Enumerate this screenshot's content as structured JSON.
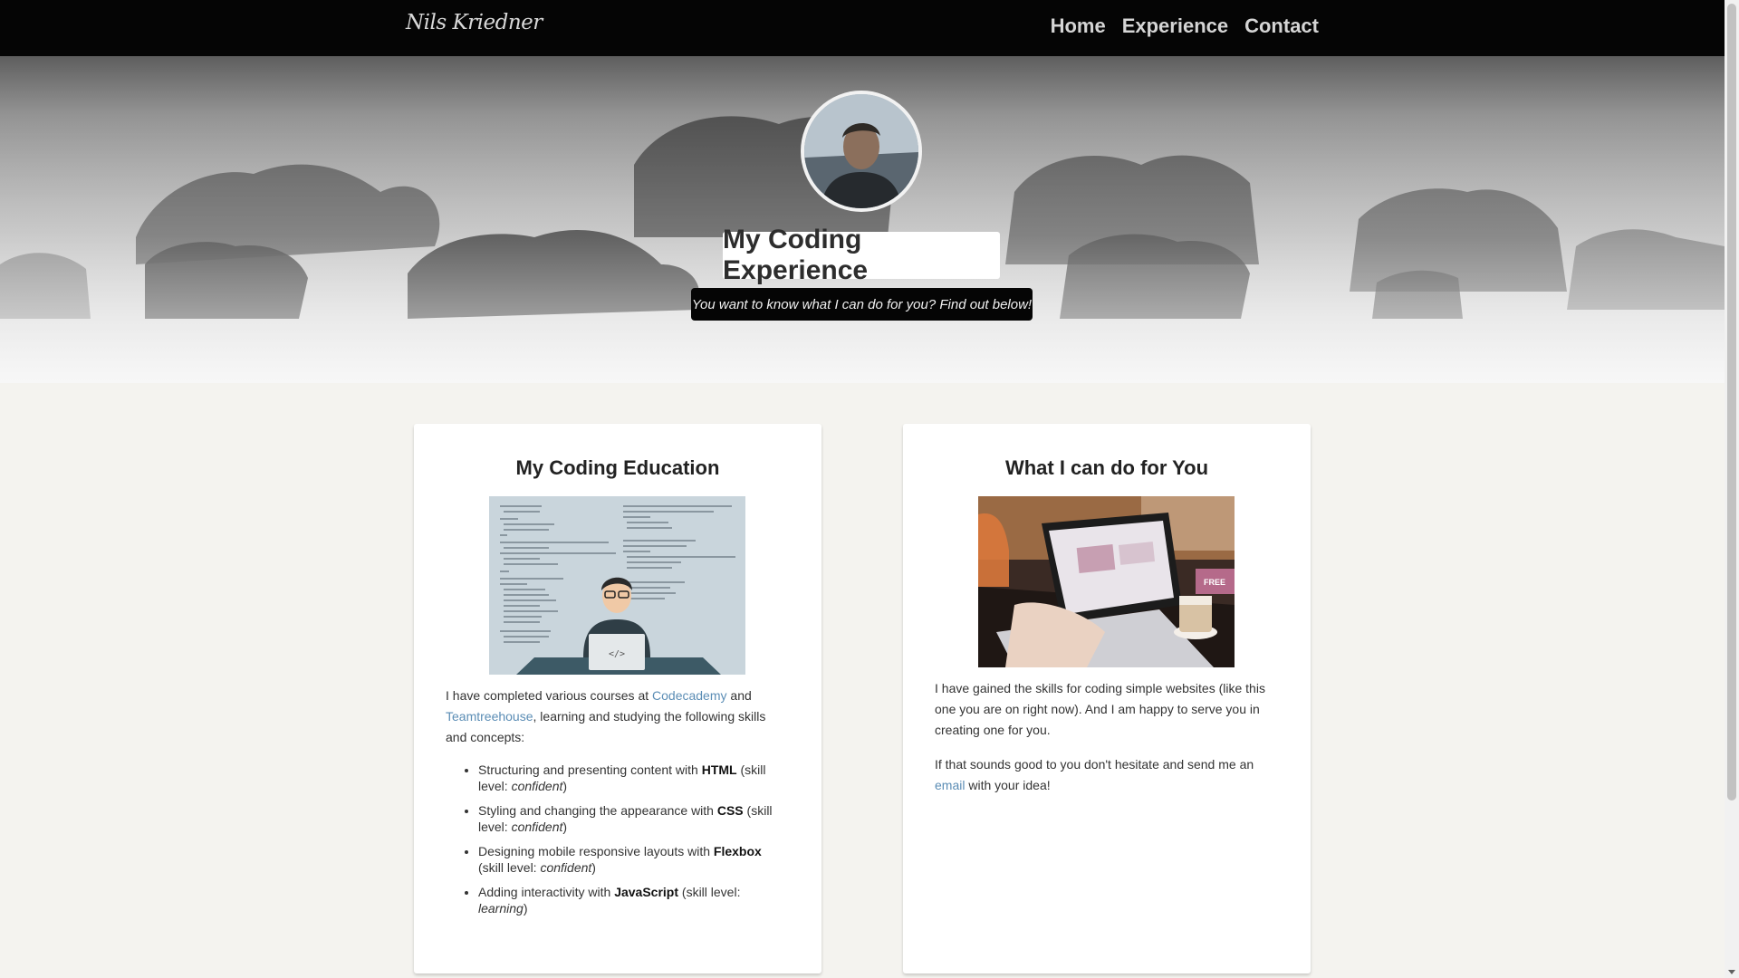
{
  "nav": {
    "brand": "Nils Kriedner",
    "links": [
      "Home",
      "Experience",
      "Contact"
    ]
  },
  "hero": {
    "title": "My Coding Experience",
    "subtitle": "You want to know what I can do for you? Find out below!"
  },
  "education": {
    "heading": "My Coding Education",
    "intro_1": "I have completed various courses at ",
    "link_codecademy": "Codecademy",
    "intro_2": " and ",
    "link_teamtreehouse": "Teamtreehouse",
    "intro_3": ", learning and studying the following skills and concepts:",
    "skills": [
      {
        "text": "Structuring and presenting content with ",
        "tech": "HTML",
        "mid": " (skill level: ",
        "level": "confident",
        "end": ")"
      },
      {
        "text": "Styling and changing the appearance with ",
        "tech": "CSS",
        "mid": " (skill level: ",
        "level": "confident",
        "end": ")"
      },
      {
        "text": "Designing mobile responsive layouts with ",
        "tech": "Flexbox",
        "mid": " (skill level: ",
        "level": "confident",
        "end": ")"
      },
      {
        "text": "Adding interactivity with ",
        "tech": "JavaScript",
        "mid": " (skill level: ",
        "level": "learning",
        "end": ")"
      }
    ],
    "image_label": "</>"
  },
  "services": {
    "heading": "What I can do for You",
    "para_1": "I have gained the skills for coding simple websites (like this one you are on right now). And I am happy to serve you in creating one for you.",
    "para_2_a": "If that sounds good to you don't hesitate and send me an ",
    "link_email": "email",
    "para_2_b": " with your idea!",
    "image_badge": "FREE"
  },
  "colors": {
    "nav_bg": "#050505",
    "link": "#5b8db5",
    "page_bg": "#f4f3ef"
  }
}
